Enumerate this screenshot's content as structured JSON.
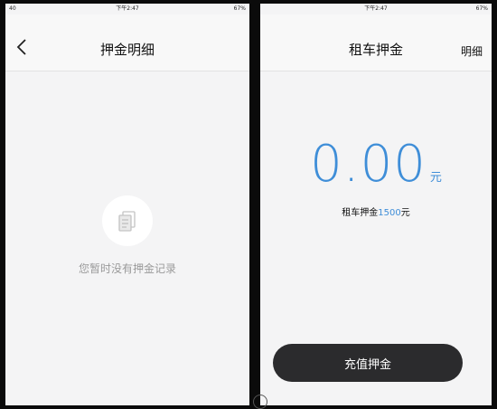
{
  "left": {
    "status": {
      "left": "40",
      "time": "下午2:47",
      "right": "67%"
    },
    "title": "押金明细",
    "empty_text": "您暂时没有押金记录"
  },
  "right": {
    "status": {
      "time": "下午2:47",
      "right": "67%"
    },
    "title": "租车押金",
    "detail_link": "明细",
    "amount": "0.00",
    "unit": "元",
    "deposit_label": "租车押金",
    "deposit_value": "1500",
    "deposit_unit": "元",
    "recharge_button": "充值押金"
  },
  "colors": {
    "accent": "#3f8ed8",
    "button": "#2b2b2d"
  }
}
